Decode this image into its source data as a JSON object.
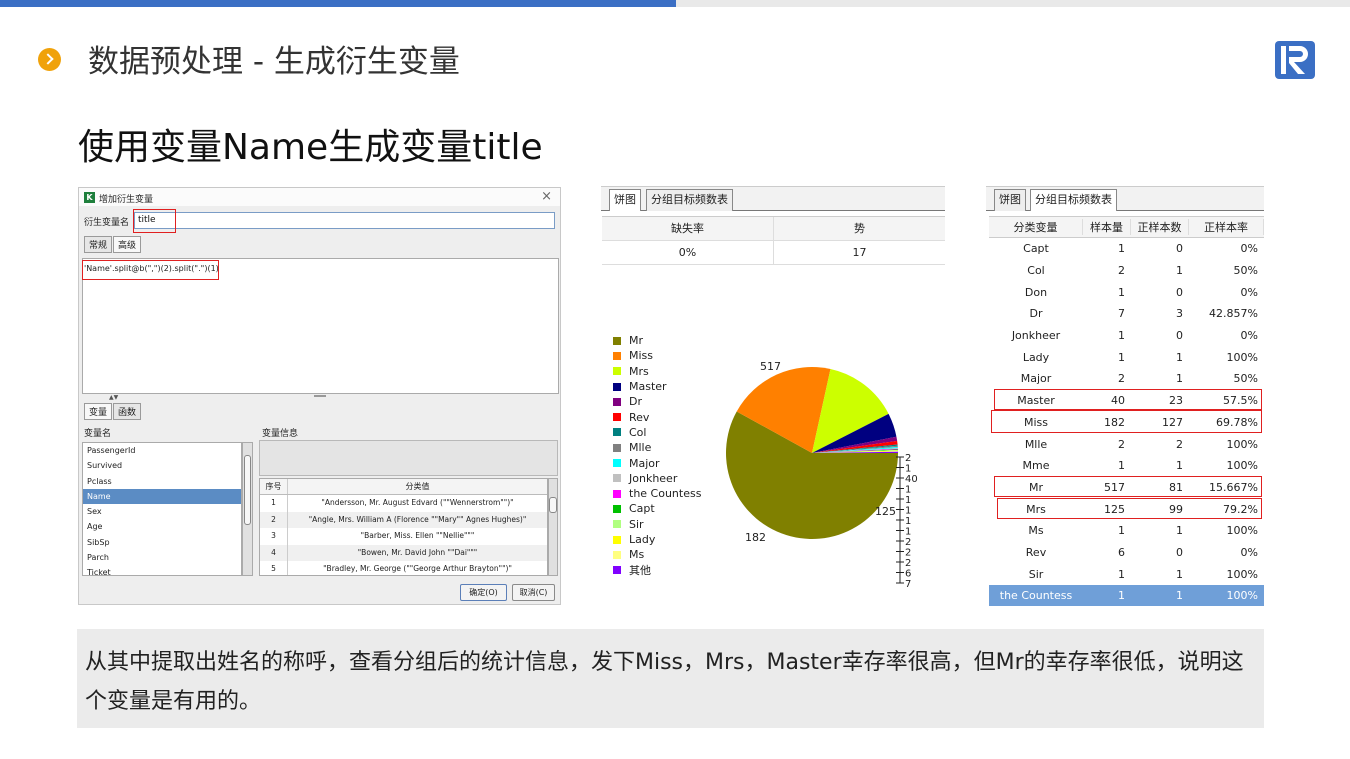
{
  "slide": {
    "title": "数据预处理 - 生成衍生变量",
    "subtitle": "使用变量Name生成变量title",
    "caption": "从其中提取出姓名的称呼，查看分组后的统计信息，发下Miss，Mrs，Master幸存率很高，但Mr的幸存率很低，说明这个变量是有用的。"
  },
  "dialog": {
    "title": "增加衍生变量",
    "icon_letter": "K",
    "var_name_label": "衍生变量名",
    "var_name_value": "title",
    "tabs": [
      "常规",
      "高级"
    ],
    "expression": "'Name'.split@b(\",\")(2).split(\".\")(1)",
    "bottom_tabs": [
      "变量",
      "函数"
    ],
    "var_list_header": "变量名",
    "var_info_header": "变量信息",
    "variables": [
      "PassengerId",
      "Survived",
      "Pclass",
      "Name",
      "Sex",
      "Age",
      "SibSp",
      "Parch",
      "Ticket"
    ],
    "selected_variable": "Name",
    "class_table": {
      "headers": [
        "序号",
        "分类值"
      ],
      "rows": [
        [
          "1",
          "\"Andersson, Mr. August Edvard (\"\"Wennerstrom\"\")\""
        ],
        [
          "2",
          "\"Angle, Mrs. William A (Florence \"\"Mary\"\" Agnes Hughes)\""
        ],
        [
          "3",
          "\"Barber, Miss. Ellen \"\"Nellie\"\"\""
        ],
        [
          "4",
          "\"Bowen, Mr. David John \"\"Dai\"\"\""
        ],
        [
          "5",
          "\"Bradley, Mr. George (\"\"George Arthur Brayton\"\")\""
        ]
      ]
    },
    "ok_label": "确定(O)",
    "cancel_label": "取消(C)"
  },
  "pie_panel": {
    "tabs": [
      "饼图",
      "分组目标频数表"
    ],
    "stats_headers": [
      "缺失率",
      "势"
    ],
    "stats_values": [
      "0%",
      "17"
    ],
    "legend": [
      {
        "name": "Mr",
        "color": "#808000"
      },
      {
        "name": "Miss",
        "color": "#ff8000"
      },
      {
        "name": "Mrs",
        "color": "#ccff00"
      },
      {
        "name": "Master",
        "color": "#000080"
      },
      {
        "name": "Dr",
        "color": "#800080"
      },
      {
        "name": "Rev",
        "color": "#ff0000"
      },
      {
        "name": "Col",
        "color": "#008080"
      },
      {
        "name": "Mlle",
        "color": "#808080"
      },
      {
        "name": "Major",
        "color": "#00ffff"
      },
      {
        "name": "Jonkheer",
        "color": "#c0c0c0"
      },
      {
        "name": "the Countess",
        "color": "#ff00ff"
      },
      {
        "name": "Capt",
        "color": "#00c000"
      },
      {
        "name": "Sir",
        "color": "#b0ff80"
      },
      {
        "name": "Lady",
        "color": "#ffff00"
      },
      {
        "name": "Ms",
        "color": "#ffff80"
      },
      {
        "name": "其他",
        "color": "#8000ff"
      }
    ]
  },
  "chart_data": {
    "type": "pie",
    "categories": [
      "Mr",
      "Miss",
      "Mrs",
      "Master",
      "Dr",
      "Rev",
      "Col",
      "Mlle",
      "Major",
      "Jonkheer",
      "the Countess",
      "Capt",
      "Sir",
      "Lady",
      "Ms",
      "其他"
    ],
    "values": [
      517,
      182,
      125,
      40,
      7,
      6,
      2,
      2,
      2,
      1,
      1,
      1,
      1,
      1,
      1,
      2
    ],
    "data_labels": [
      "517",
      "182",
      "125",
      "40",
      "7",
      "6",
      "2",
      "2",
      "2",
      "1",
      "1",
      "1",
      "1",
      "1",
      "1",
      "2"
    ],
    "legend_position": "left"
  },
  "freq_panel": {
    "tabs": [
      "饼图",
      "分组目标频数表"
    ],
    "headers": [
      "分类变量",
      "样本量",
      "正样本数",
      "正样本率"
    ],
    "rows": [
      [
        "Capt",
        "1",
        "0",
        "0%"
      ],
      [
        "Col",
        "2",
        "1",
        "50%"
      ],
      [
        "Don",
        "1",
        "0",
        "0%"
      ],
      [
        "Dr",
        "7",
        "3",
        "42.857%"
      ],
      [
        "Jonkheer",
        "1",
        "0",
        "0%"
      ],
      [
        "Lady",
        "1",
        "1",
        "100%"
      ],
      [
        "Major",
        "2",
        "1",
        "50%"
      ],
      [
        "Master",
        "40",
        "23",
        "57.5%"
      ],
      [
        "Miss",
        "182",
        "127",
        "69.78%"
      ],
      [
        "Mlle",
        "2",
        "2",
        "100%"
      ],
      [
        "Mme",
        "1",
        "1",
        "100%"
      ],
      [
        "Mr",
        "517",
        "81",
        "15.667%"
      ],
      [
        "Mrs",
        "125",
        "99",
        "79.2%"
      ],
      [
        "Ms",
        "1",
        "1",
        "100%"
      ],
      [
        "Rev",
        "6",
        "0",
        "0%"
      ],
      [
        "Sir",
        "1",
        "1",
        "100%"
      ],
      [
        "the Countess",
        "1",
        "1",
        "100%"
      ]
    ],
    "selected_row": "the Countess"
  }
}
